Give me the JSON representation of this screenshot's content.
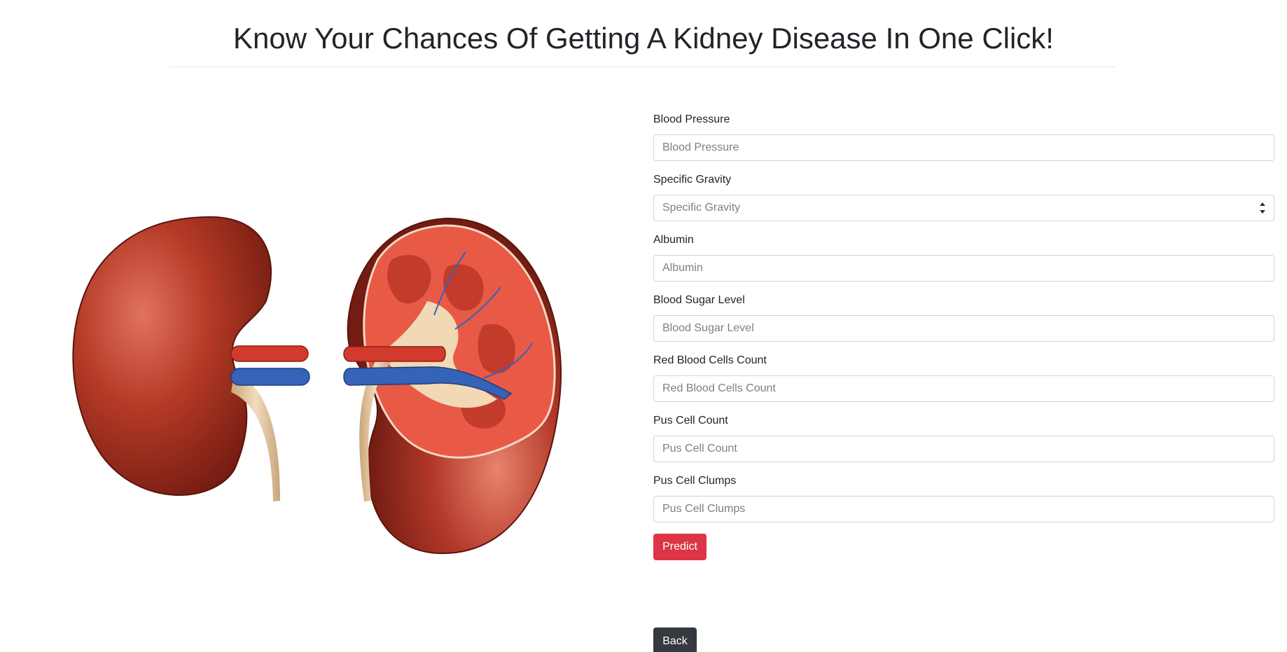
{
  "header": {
    "title": "Know Your Chances Of Getting A Kidney Disease In One Click!"
  },
  "illustration": {
    "subject": "kidney-anatomy-illustration",
    "colors": {
      "kidney": "#b0301f",
      "kidney_dark": "#7a1a10",
      "artery": "#d0342a",
      "vein": "#2f5fb3",
      "ureter": "#e0c195",
      "cortex": "#e85a45"
    }
  },
  "form": {
    "fields": [
      {
        "label": "Blood Pressure",
        "placeholder": "Blood Pressure",
        "value": ""
      },
      {
        "label": "Specific Gravity",
        "placeholder": "Specific Gravity",
        "value": ""
      },
      {
        "label": "Albumin",
        "placeholder": "Albumin",
        "value": ""
      },
      {
        "label": "Blood Sugar Level",
        "placeholder": "Blood Sugar Level",
        "value": ""
      },
      {
        "label": "Red Blood Cells Count",
        "placeholder": "Red Blood Cells Count",
        "value": ""
      },
      {
        "label": "Pus Cell Count",
        "placeholder": "Pus Cell Count",
        "value": ""
      },
      {
        "label": "Pus Cell Clumps",
        "placeholder": "Pus Cell Clumps",
        "value": ""
      }
    ],
    "predict_label": "Predict",
    "back_label": "Back"
  },
  "colors": {
    "predict": "#dc3545",
    "back": "#343a40",
    "border": "#ced4da"
  }
}
